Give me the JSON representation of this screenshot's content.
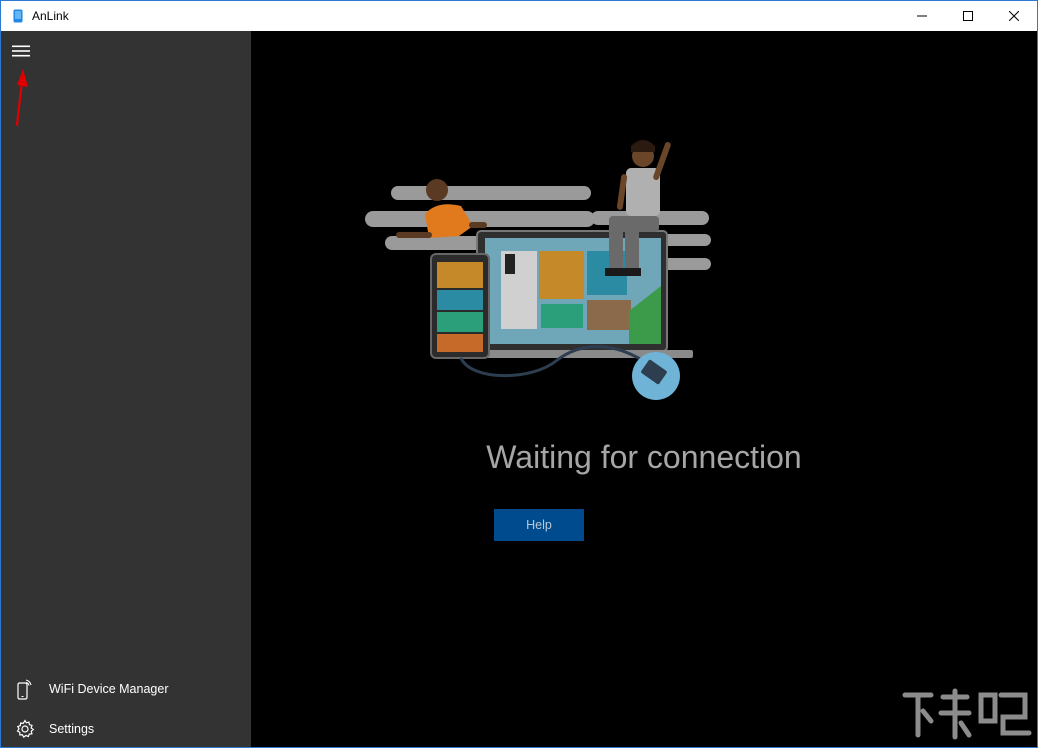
{
  "window": {
    "title": "AnLink"
  },
  "sidebar": {
    "items": [
      {
        "label": "WiFi Device Manager",
        "icon": "phone-wifi-icon"
      },
      {
        "label": "Settings",
        "icon": "gear-icon"
      }
    ]
  },
  "main": {
    "status": "Waiting for connection",
    "help_label": "Help"
  },
  "colors": {
    "sidebar_bg": "#333333",
    "main_bg": "#000000",
    "accent": "#004b8d",
    "status_text": "#a6a6a6",
    "annotation_arrow": "#e00000"
  }
}
